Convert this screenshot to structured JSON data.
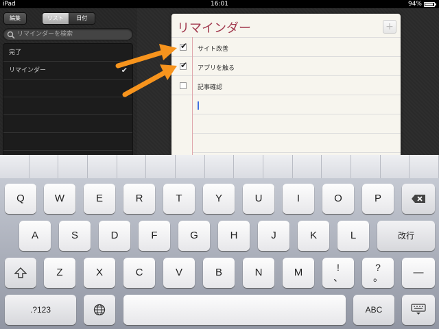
{
  "status": {
    "device": "iPad",
    "time": "16:01",
    "battery": "94%"
  },
  "sidebar": {
    "edit_label": "編集",
    "segment_list": "リスト",
    "segment_date": "日付",
    "search_placeholder": "リマインダーを検索",
    "lists": [
      {
        "label": "完了",
        "checked": false
      },
      {
        "label": "リマインダー",
        "checked": true
      }
    ]
  },
  "reminders": {
    "title": "リマインダー",
    "add_label": "+",
    "tasks": [
      {
        "text": "サイト改善",
        "done": true
      },
      {
        "text": "アプリを触る",
        "done": true
      },
      {
        "text": "記事確認",
        "done": false
      }
    ]
  },
  "keyboard": {
    "row1": [
      "Q",
      "W",
      "E",
      "R",
      "T",
      "Y",
      "U",
      "I",
      "O",
      "P"
    ],
    "row2": [
      "A",
      "S",
      "D",
      "F",
      "G",
      "H",
      "J",
      "K",
      "L"
    ],
    "row3": [
      "Z",
      "X",
      "C",
      "V",
      "B",
      "N",
      "M"
    ],
    "return_label": "改行",
    "excl_upper": "!",
    "excl_lower": "、",
    "quest_upper": "?",
    "quest_lower": "。",
    "dash_label": "—",
    "num_label": ".?123",
    "abc_label": "ABC"
  },
  "colors": {
    "title": "#a23a4f",
    "arrow": "#f7941d",
    "cursor": "#3f6fe0"
  }
}
